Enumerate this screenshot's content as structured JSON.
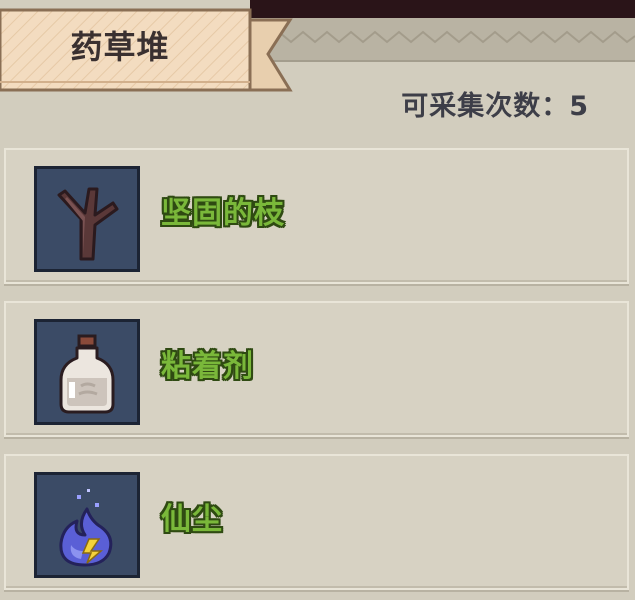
{
  "header": {
    "title": "药草堆",
    "collect_count_label": "可采集次数：",
    "collect_count_value": "5"
  },
  "colors": {
    "panel_bg": "#d2cdbe",
    "title_banner": "#f3dcc0",
    "item_name": "#7ab83a",
    "item_name_outline": "#2f4a12",
    "icon_bg": "#3b4b66"
  },
  "items": [
    {
      "name": "坚固的枝",
      "icon": "stick-icon"
    },
    {
      "name": "粘着剂",
      "icon": "bottle-icon"
    },
    {
      "name": "仙尘",
      "icon": "fairy-dust-icon"
    }
  ]
}
